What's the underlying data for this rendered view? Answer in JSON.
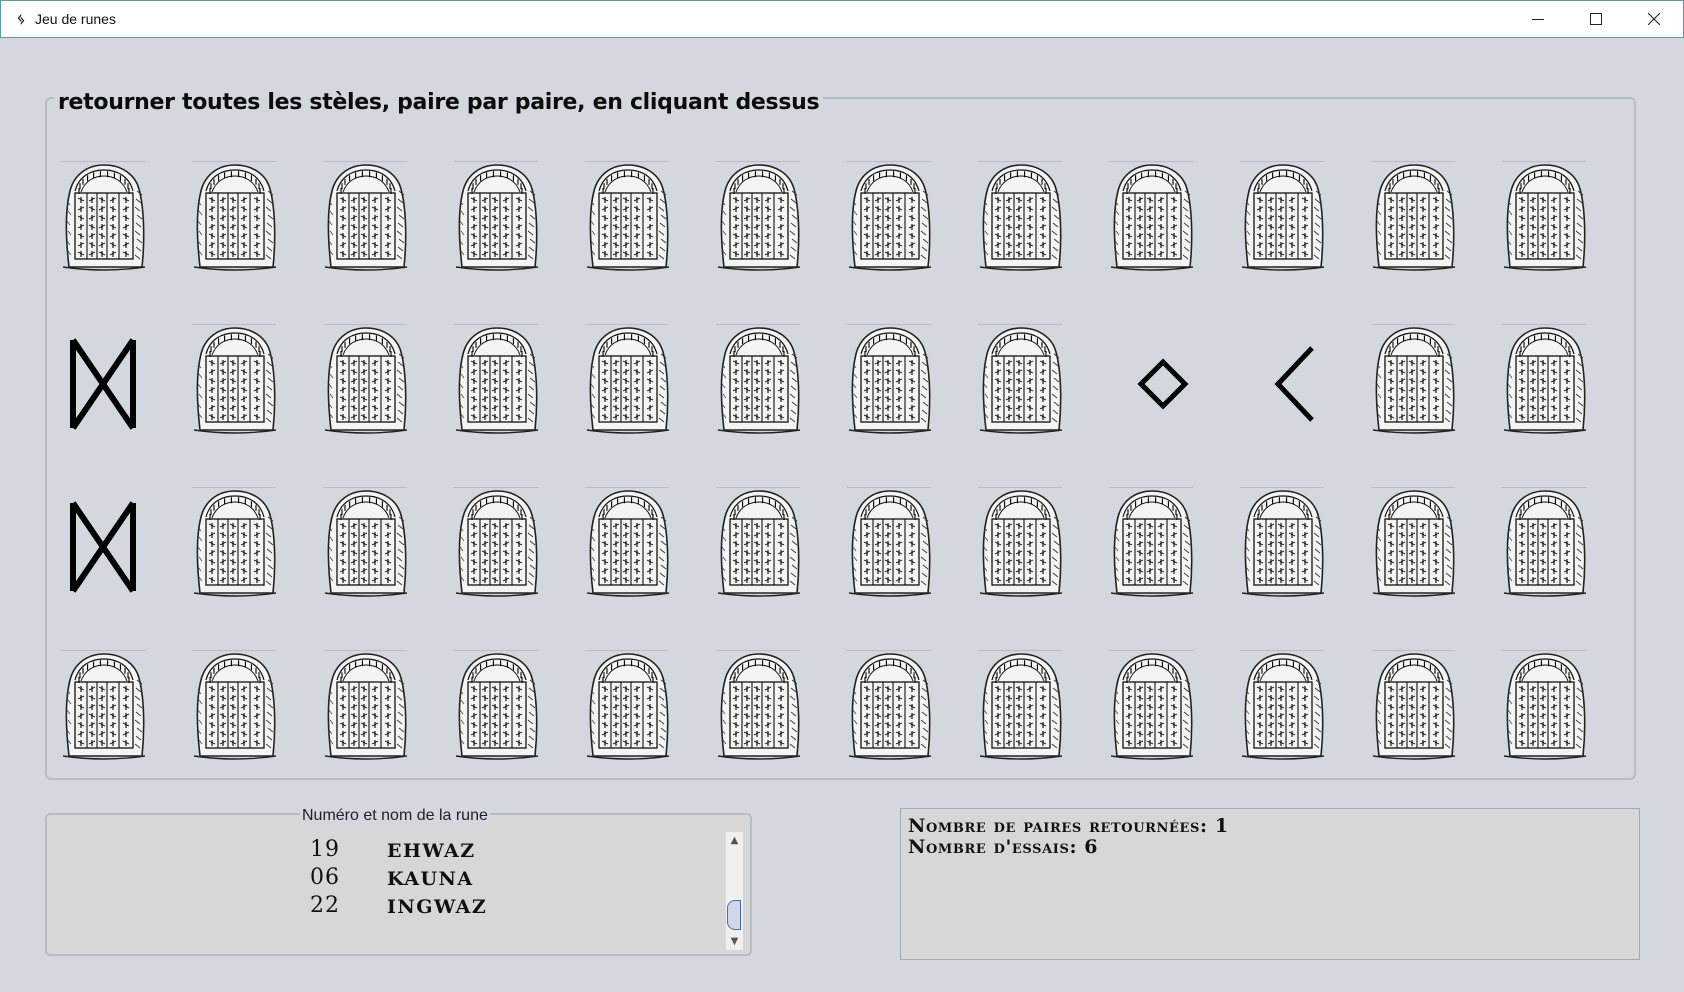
{
  "window": {
    "title": "Jeu de runes",
    "icon": "rune-app-icon",
    "controls": [
      "minimize-icon",
      "maximize-icon",
      "close-icon"
    ]
  },
  "board": {
    "instruction": "retourner toutes les stèles, paire par paire, en cliquant dessus",
    "rows": 4,
    "columns": 12,
    "face_down_icon": "rune-stele-icon",
    "cells": [
      [
        "stele",
        "stele",
        "stele",
        "stele",
        "stele",
        "stele",
        "stele",
        "stele",
        "stele",
        "stele",
        "stele",
        "stele"
      ],
      [
        "dagaz",
        "stele",
        "stele",
        "stele",
        "stele",
        "stele",
        "stele",
        "stele",
        "ingwaz",
        "kauna",
        "stele",
        "stele"
      ],
      [
        "dagaz",
        "stele",
        "stele",
        "stele",
        "stele",
        "stele",
        "stele",
        "stele",
        "stele",
        "stele",
        "stele",
        "stele"
      ],
      [
        "stele",
        "stele",
        "stele",
        "stele",
        "stele",
        "stele",
        "stele",
        "stele",
        "stele",
        "stele",
        "stele",
        "stele"
      ]
    ]
  },
  "rune_list": {
    "title": "Numéro et nom de la rune",
    "items": [
      {
        "number": "19",
        "name": "EHWAZ"
      },
      {
        "number": "06",
        "name": "KAUNA"
      },
      {
        "number": "22",
        "name": "INGWAZ"
      }
    ]
  },
  "stats": {
    "pairs_line": "Nombre de paires retournées: 1",
    "tries_line": "Nombre d'essais: 6"
  }
}
